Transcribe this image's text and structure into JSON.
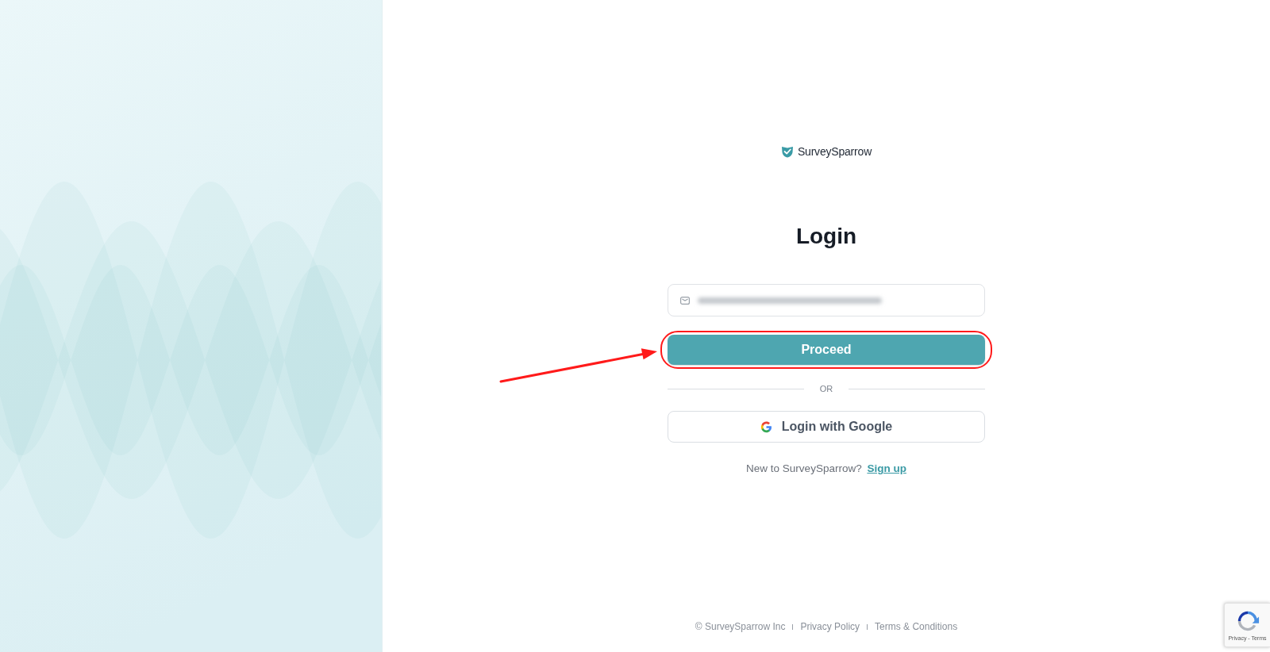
{
  "brand": {
    "name": "SurveySparrow"
  },
  "heading": "Login",
  "email_field": {
    "value_redacted": true
  },
  "primary_button": {
    "label": "Proceed",
    "highlighted": true
  },
  "divider_label": "OR",
  "google_button": {
    "label": "Login with Google"
  },
  "signup_prompt": {
    "text": "New to SurveySparrow?",
    "link": "Sign up"
  },
  "footer": {
    "copyright": "© SurveySparrow Inc",
    "links": [
      "Privacy Policy",
      "Terms & Conditions"
    ]
  },
  "recaptcha_badge": {
    "text": "Privacy - Terms"
  },
  "annotations": [
    {
      "kind": "arrow"
    }
  ]
}
